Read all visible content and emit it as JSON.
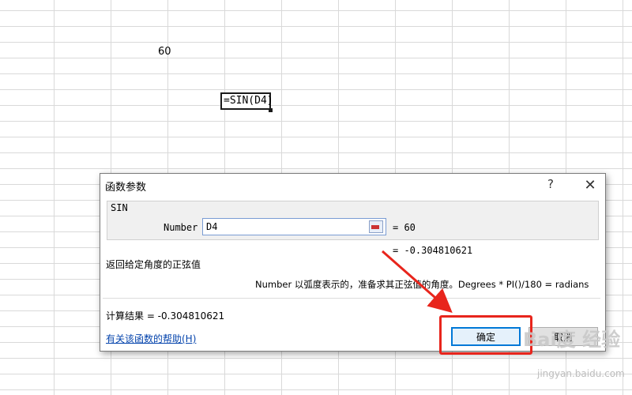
{
  "sheet": {
    "cell_value": "60",
    "active_cell_formula": "=SIN(D4)"
  },
  "dialog": {
    "title": "函数参数",
    "help_glyph": "?",
    "close_glyph": "✕",
    "function_name": "SIN",
    "argument": {
      "label": "Number",
      "value": "D4",
      "evaluated": "=  60"
    },
    "formula_result_line": "=  -0.304810621",
    "description": "返回给定角度的正弦值",
    "argument_description": "Number  以弧度表示的，准备求其正弦值的角度。Degrees * PI()/180 = radians",
    "result_label": "计算结果 =  -0.304810621",
    "help_link": "有关该函数的帮助(H)",
    "ok_label": "确定",
    "cancel_label": "取消"
  },
  "annotation": {
    "highlight_color": "#e8251c"
  },
  "watermark": {
    "brand": "Bai度 经验",
    "url": "jingyan.baidu.com"
  }
}
